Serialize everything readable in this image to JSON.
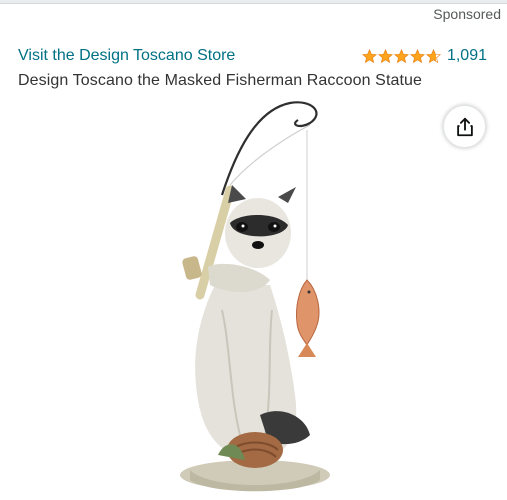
{
  "sponsored_label": "Sponsored",
  "store_link": "Visit the Design Toscano Store",
  "rating": {
    "stars": 4.5,
    "count": "1,091"
  },
  "product_title": "Design Toscano the Masked Fisherman Raccoon Statue",
  "icons": {
    "share": "share-icon",
    "star": "star-icon"
  },
  "colors": {
    "link": "#007185",
    "star": "#ffa41c",
    "title": "#333333"
  }
}
